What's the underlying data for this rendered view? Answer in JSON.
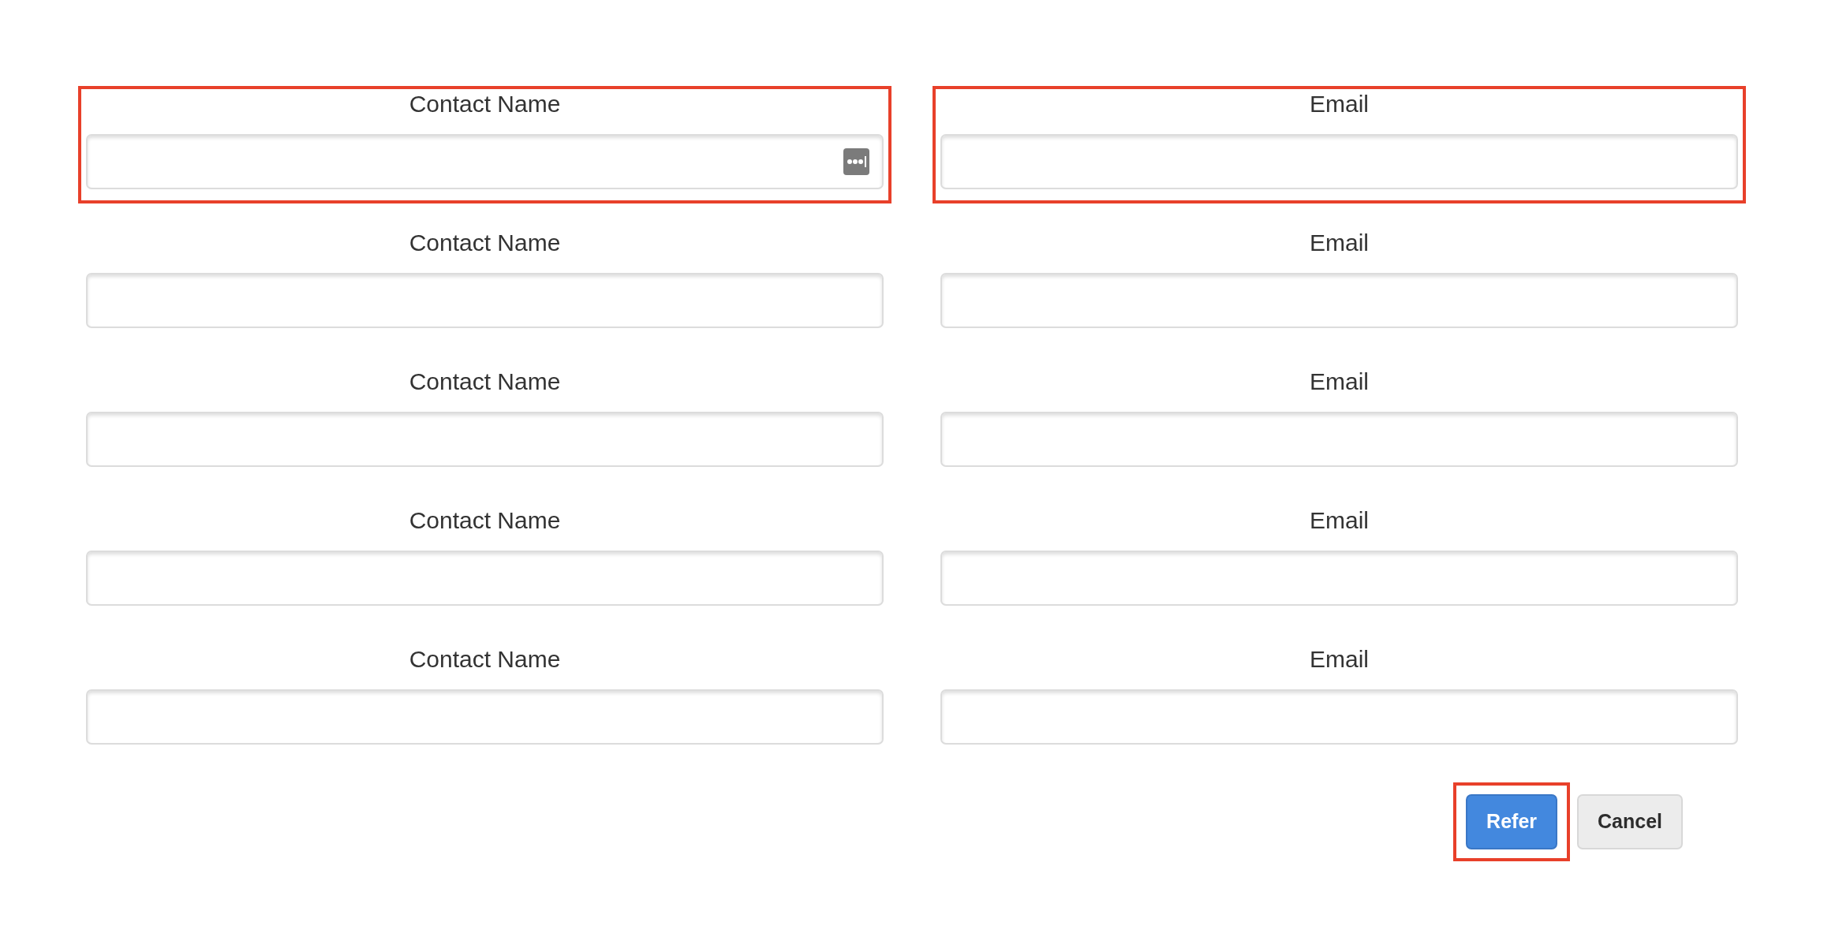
{
  "rows": [
    {
      "contact": {
        "label": "Contact Name",
        "highlighted": true,
        "autofill_icon": true
      },
      "email": {
        "label": "Email",
        "highlighted": true,
        "autofill_icon": false
      }
    },
    {
      "contact": {
        "label": "Contact Name",
        "highlighted": false,
        "autofill_icon": false
      },
      "email": {
        "label": "Email",
        "highlighted": false,
        "autofill_icon": false
      }
    },
    {
      "contact": {
        "label": "Contact Name",
        "highlighted": false,
        "autofill_icon": false
      },
      "email": {
        "label": "Email",
        "highlighted": false,
        "autofill_icon": false
      }
    },
    {
      "contact": {
        "label": "Contact Name",
        "highlighted": false,
        "autofill_icon": false
      },
      "email": {
        "label": "Email",
        "highlighted": false,
        "autofill_icon": false
      }
    },
    {
      "contact": {
        "label": "Contact Name",
        "highlighted": false,
        "autofill_icon": false
      },
      "email": {
        "label": "Email",
        "highlighted": false,
        "autofill_icon": false
      }
    }
  ],
  "buttons": [
    {
      "label": "Refer",
      "kind": "primary",
      "highlighted": true
    },
    {
      "label": "Cancel",
      "kind": "secondary",
      "highlighted": false
    }
  ]
}
